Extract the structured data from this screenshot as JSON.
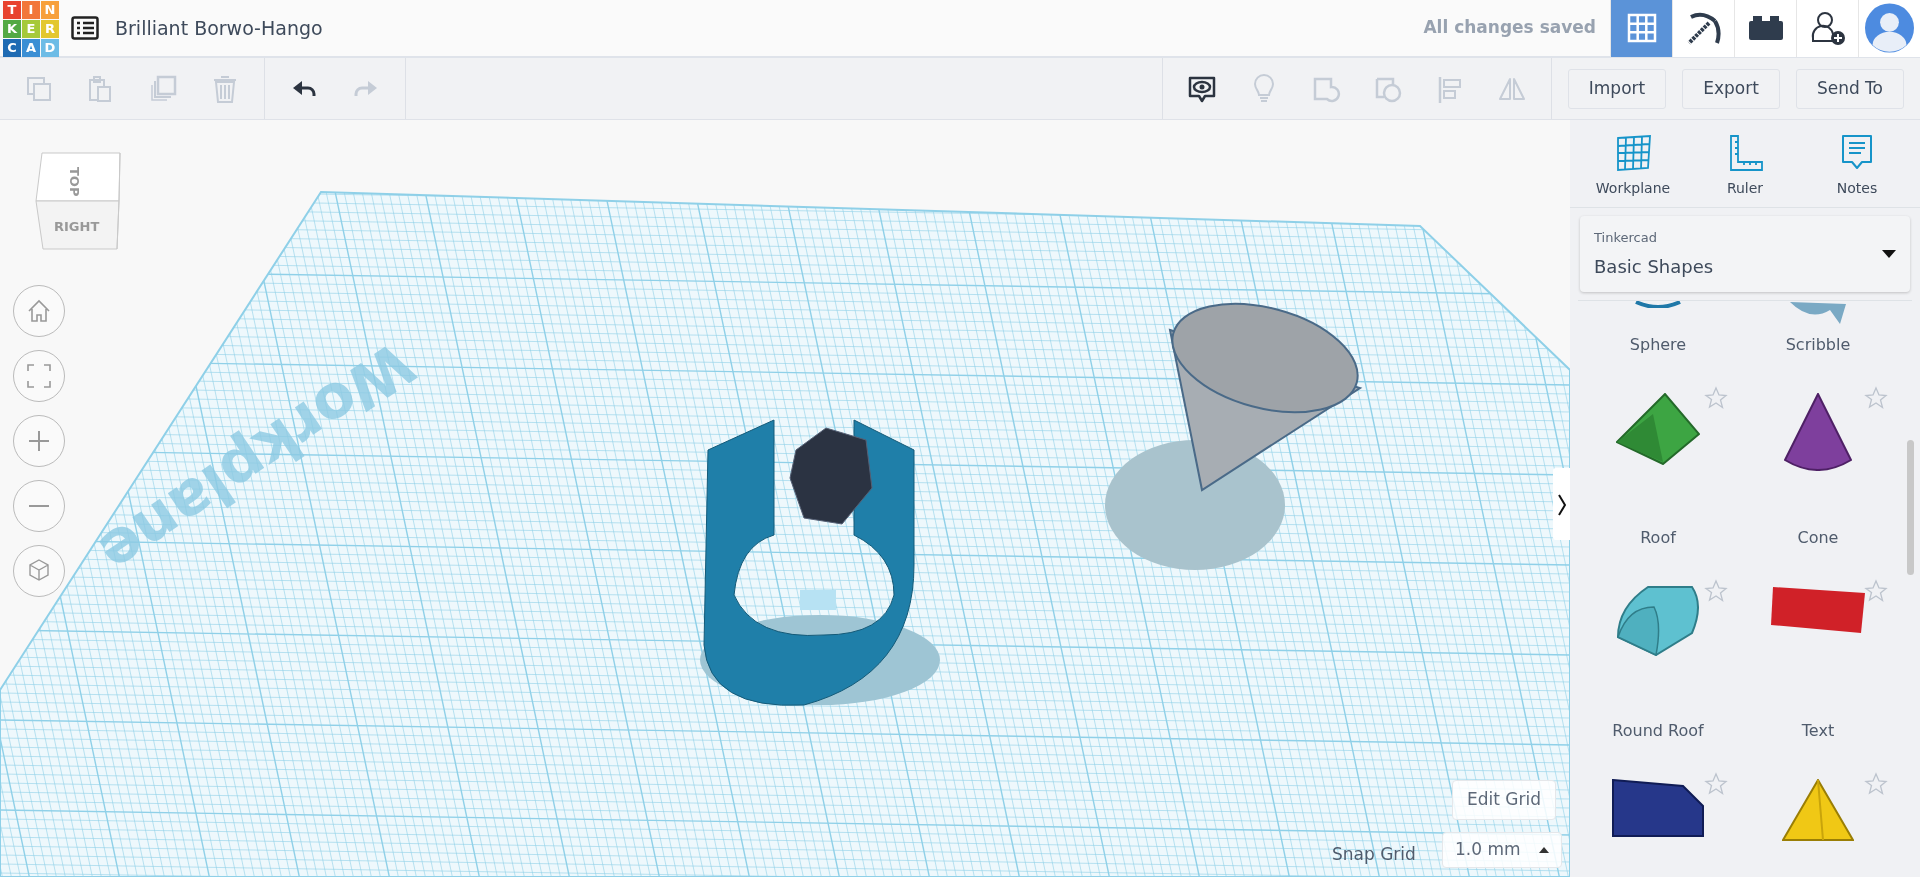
{
  "header": {
    "logo": [
      {
        "letter": "T",
        "color": "#e8432f"
      },
      {
        "letter": "I",
        "color": "#f2763a"
      },
      {
        "letter": "N",
        "color": "#f7a03b"
      },
      {
        "letter": "K",
        "color": "#53a944"
      },
      {
        "letter": "E",
        "color": "#a6c93a"
      },
      {
        "letter": "R",
        "color": "#e3c72f"
      },
      {
        "letter": "C",
        "color": "#1f6bb3"
      },
      {
        "letter": "A",
        "color": "#3b8fd4"
      },
      {
        "letter": "D",
        "color": "#6dbce6"
      }
    ],
    "title": "Brilliant Borwo-Hango",
    "save_status": "All changes saved",
    "views": [
      {
        "kind": "grid",
        "selected": true
      },
      {
        "kind": "pickaxe",
        "selected": false
      },
      {
        "kind": "bricks",
        "selected": false
      }
    ]
  },
  "toolbar": {
    "edit_tools": [
      {
        "kind": "copy",
        "disabled": true
      },
      {
        "kind": "paste",
        "disabled": true
      },
      {
        "kind": "duplicate",
        "disabled": true
      },
      {
        "kind": "delete",
        "disabled": true
      }
    ],
    "history": [
      {
        "kind": "undo",
        "disabled": false
      },
      {
        "kind": "redo",
        "disabled": true
      }
    ],
    "view_tools": [
      {
        "kind": "notes",
        "disabled": false
      },
      {
        "kind": "bulb",
        "disabled": true
      },
      {
        "kind": "group",
        "disabled": true
      },
      {
        "kind": "ungroup",
        "disabled": true
      },
      {
        "kind": "align",
        "disabled": true
      },
      {
        "kind": "mirror",
        "disabled": true
      }
    ],
    "buttons": [
      "Import",
      "Export",
      "Send To"
    ]
  },
  "viewport": {
    "view_cube": {
      "top": "TOP",
      "side": "RIGHT"
    },
    "plane_label": "Workplane",
    "nav": [
      {
        "kind": "home"
      },
      {
        "kind": "fit"
      },
      {
        "kind": "zoom-in"
      },
      {
        "kind": "zoom-out"
      },
      {
        "kind": "perspective"
      }
    ],
    "edit_grid": "Edit Grid",
    "snap_label": "Snap Grid",
    "snap_value": "1.0 mm"
  },
  "panel": {
    "tools": [
      {
        "kind": "workplane",
        "label": "Workplane"
      },
      {
        "kind": "ruler",
        "label": "Ruler"
      },
      {
        "kind": "notes",
        "label": "Notes"
      }
    ],
    "library": {
      "source": "Tinkercad",
      "name": "Basic Shapes"
    },
    "shapes": [
      {
        "kind": "sphere",
        "label": "Sphere",
        "cut_top": true
      },
      {
        "kind": "scribble",
        "label": "Scribble",
        "cut_top": true
      },
      {
        "kind": "roof",
        "label": "Roof",
        "cut_top": false
      },
      {
        "kind": "cone",
        "label": "Cone",
        "cut_top": false
      },
      {
        "kind": "round-roof",
        "label": "Round Roof",
        "cut_top": false
      },
      {
        "kind": "text",
        "label": "Text",
        "cut_top": false
      },
      {
        "kind": "box",
        "cut_top": false
      },
      {
        "kind": "pyramid",
        "cut_top": false
      }
    ]
  }
}
